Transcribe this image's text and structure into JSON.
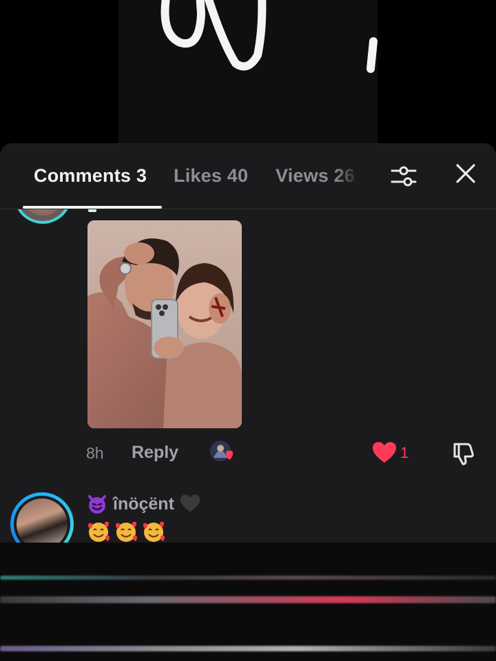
{
  "tabs": [
    {
      "label": "Comments 3",
      "active": true
    },
    {
      "label": "Likes 40",
      "active": false
    },
    {
      "label": "Views 26",
      "active": false
    }
  ],
  "icons": {
    "filter": "sliders-icon",
    "close": "close-icon",
    "like": "heart-icon",
    "dislike": "thumbs-down-icon"
  },
  "comment_1": {
    "time": "8h",
    "reply_label": "Reply",
    "like_count": "1",
    "liked": true
  },
  "comment_2": {
    "username": "înöçënt",
    "body_emojis": [
      "smiling-face-with-hearts",
      "smiling-face-with-hearts",
      "smiling-face-with-hearts"
    ]
  },
  "colors": {
    "sheet": "#1b1b1d",
    "accent_like": "#ff3b5c",
    "avatar_ring": "#3fd3d9",
    "inactive_text": "#8f8f93"
  }
}
